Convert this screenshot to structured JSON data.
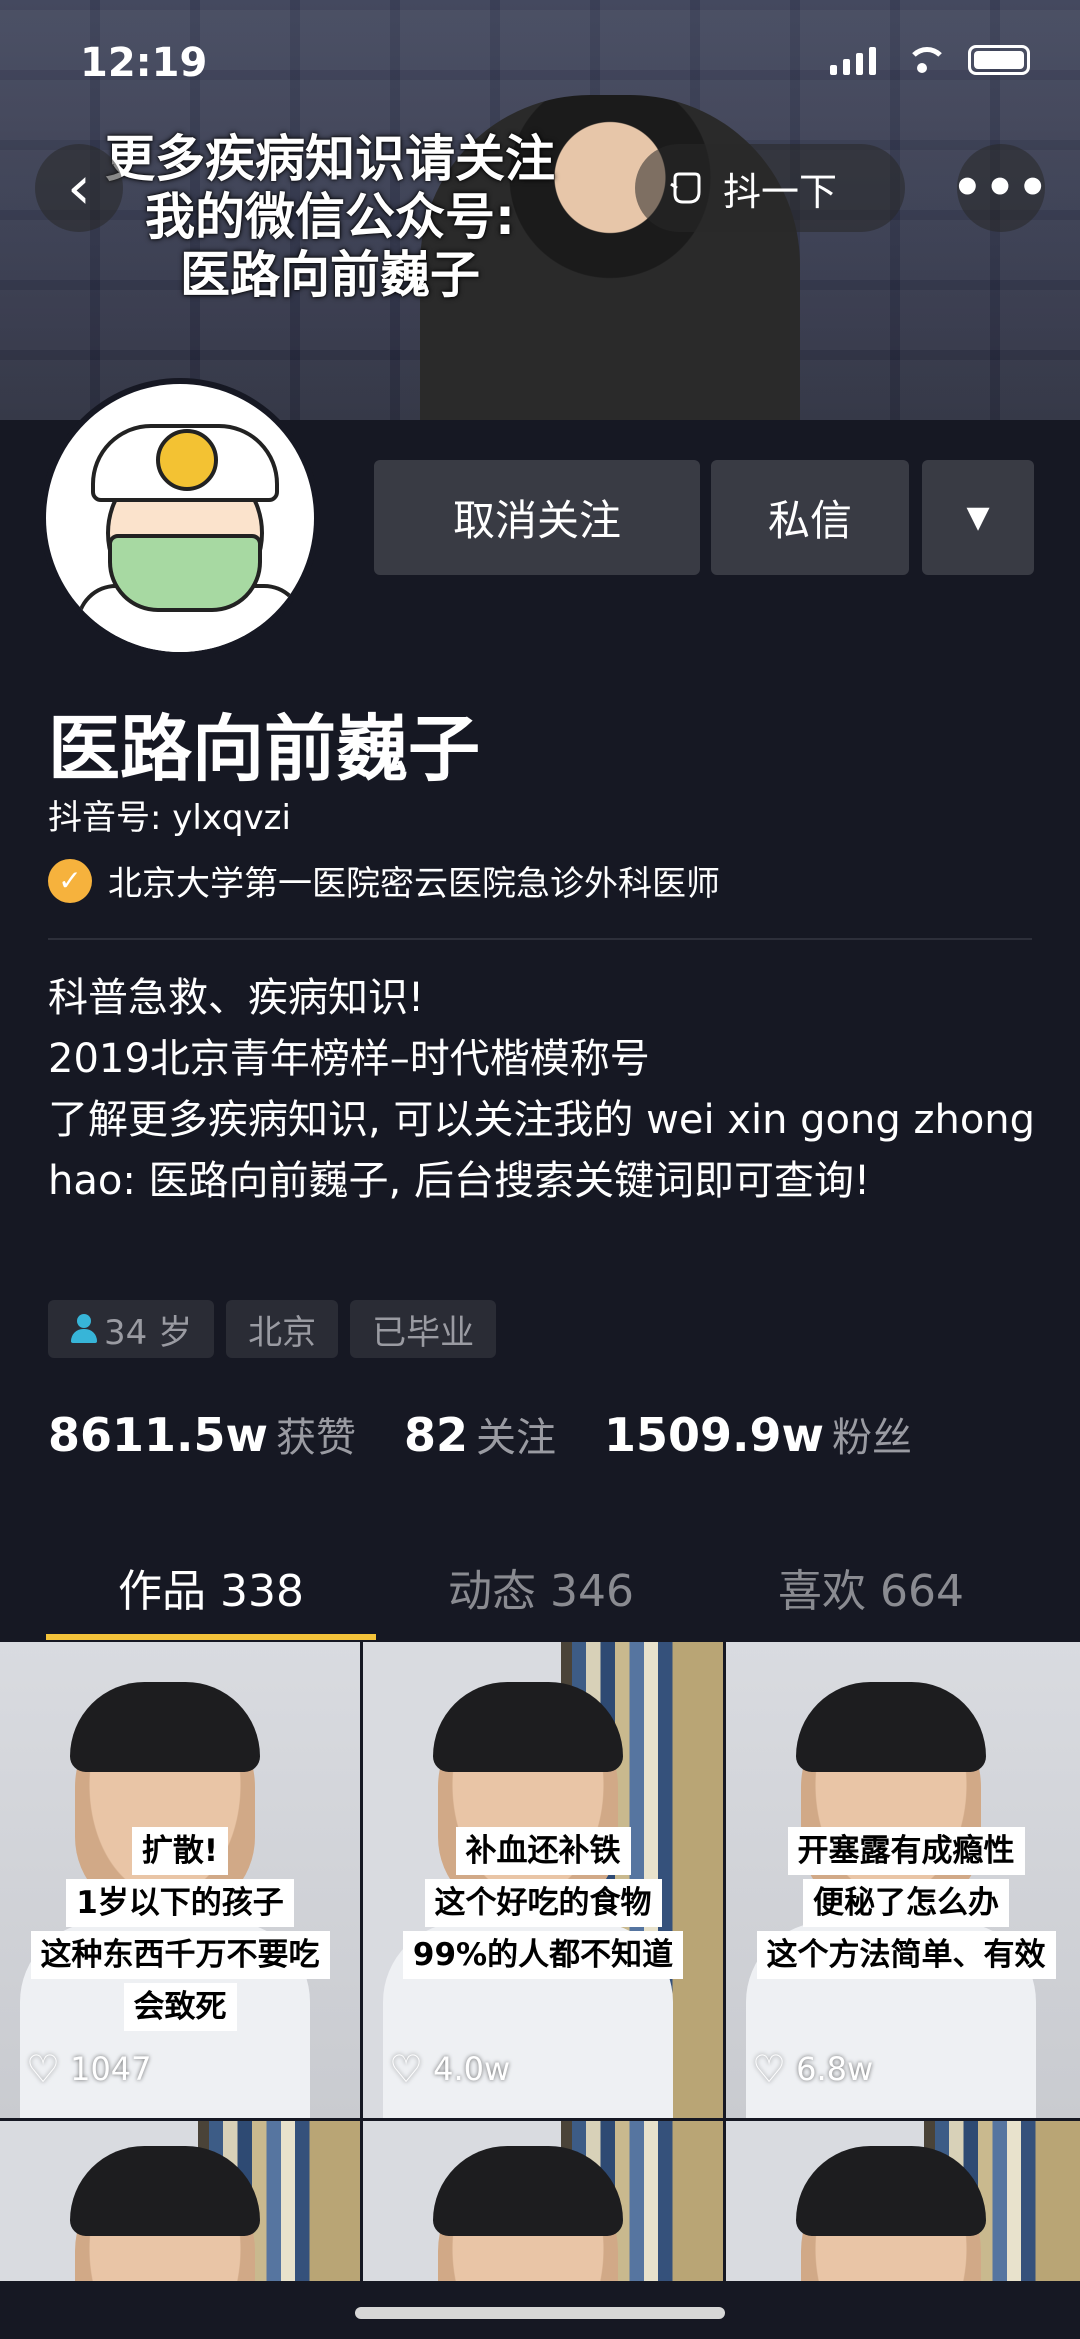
{
  "status_bar": {
    "time": "12:19"
  },
  "cover": {
    "overlay_text": [
      "更多疾病知识请关注",
      "我的微信公众号:",
      "医路向前巍子"
    ]
  },
  "nav": {
    "back_icon": "back-arrow-icon",
    "share_label": "抖一下",
    "more_icon": "more-dots-icon"
  },
  "profile": {
    "name": "医路向前巍子",
    "douyin_id": "抖音号: ylxqvzi",
    "verified_text": "北京大学第一医院密云医院急诊外科医师",
    "bio": "科普急救、疾病知识!\n2019北京青年榜样–时代楷模称号\n了解更多疾病知识, 可以关注我的 wei xin gong zhong hao: 医路向前巍子, 后台搜索关键词即可查询!",
    "tags": [
      "34 岁",
      "北京",
      "已毕业"
    ]
  },
  "actions": {
    "unfollow": "取消关注",
    "message": "私信",
    "more": "▼"
  },
  "stats": [
    {
      "num": "8611.5w",
      "label": "获赞"
    },
    {
      "num": "82",
      "label": "关注"
    },
    {
      "num": "1509.9w",
      "label": "粉丝"
    }
  ],
  "tabs": [
    "作品 338",
    "动态 346",
    "喜欢 664"
  ],
  "videos": [
    {
      "caption": [
        "扩散!",
        "1岁以下的孩子",
        "这种东西千万不要吃",
        "会致死"
      ],
      "likes": "1047"
    },
    {
      "caption": [
        "补血还补铁",
        "这个好吃的食物",
        "99%的人都不知道"
      ],
      "likes": "4.0w"
    },
    {
      "caption": [
        "开塞露有成瘾性",
        "便秘了怎么办",
        "这个方法简单、有效"
      ],
      "likes": "6.8w"
    }
  ],
  "colors": {
    "background": "#161823",
    "accent": "#f5c33a",
    "button": "#393b44"
  }
}
